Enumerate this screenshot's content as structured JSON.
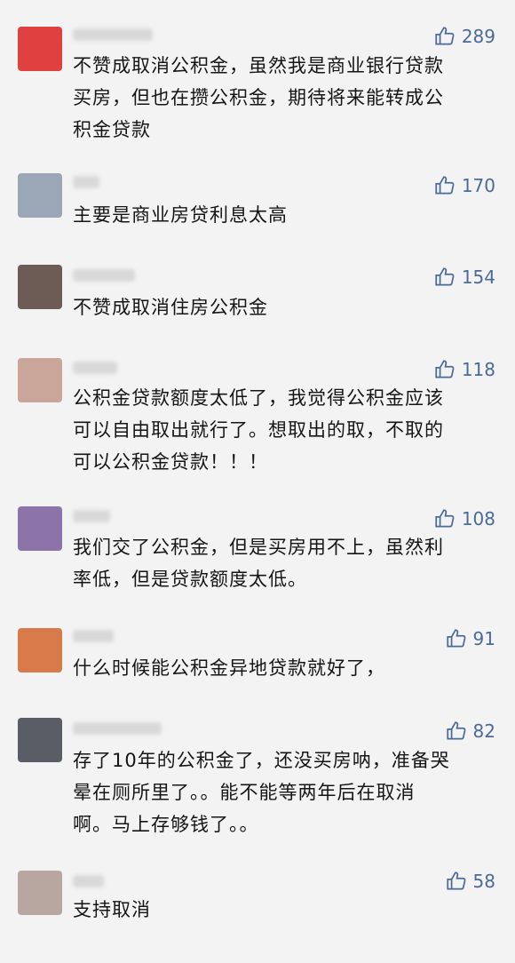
{
  "comments": [
    {
      "likes": "289",
      "text": "不赞成取消公积金，虽然我是商业银行贷款\n买房，但也在攒公积金，期待将来能转成公\n积金贷款",
      "avatar_color": "#e04040"
    },
    {
      "likes": "170",
      "text": "主要是商业房贷利息太高",
      "avatar_color": "#9aa7b6"
    },
    {
      "likes": "154",
      "text": "不赞成取消住房公积金",
      "avatar_color": "#6d5b55"
    },
    {
      "likes": "118",
      "text": "公积金贷款额度太低了，我觉得公积金应该\n可以自由取出就行了。想取出的取，不取的\n可以公积金贷款！！！",
      "avatar_color": "#c9a59a"
    },
    {
      "likes": "108",
      "text": "我们交了公积金，但是买房用不上，虽然利\n率低，但是贷款额度太低。",
      "avatar_color": "#8d74a8"
    },
    {
      "likes": "91",
      "text": "什么时候能公积金异地贷款就好了，",
      "avatar_color": "#d97a4a"
    },
    {
      "likes": "82",
      "text": "存了10年的公积金了，还没买房呐，准备哭\n晕在厕所里了。。能不能等两年后在取消\n啊。马上存够钱了。。",
      "avatar_color": "#5a5d66"
    },
    {
      "likes": "58",
      "text": "支持取消",
      "avatar_color": "#b7a7a0"
    }
  ]
}
